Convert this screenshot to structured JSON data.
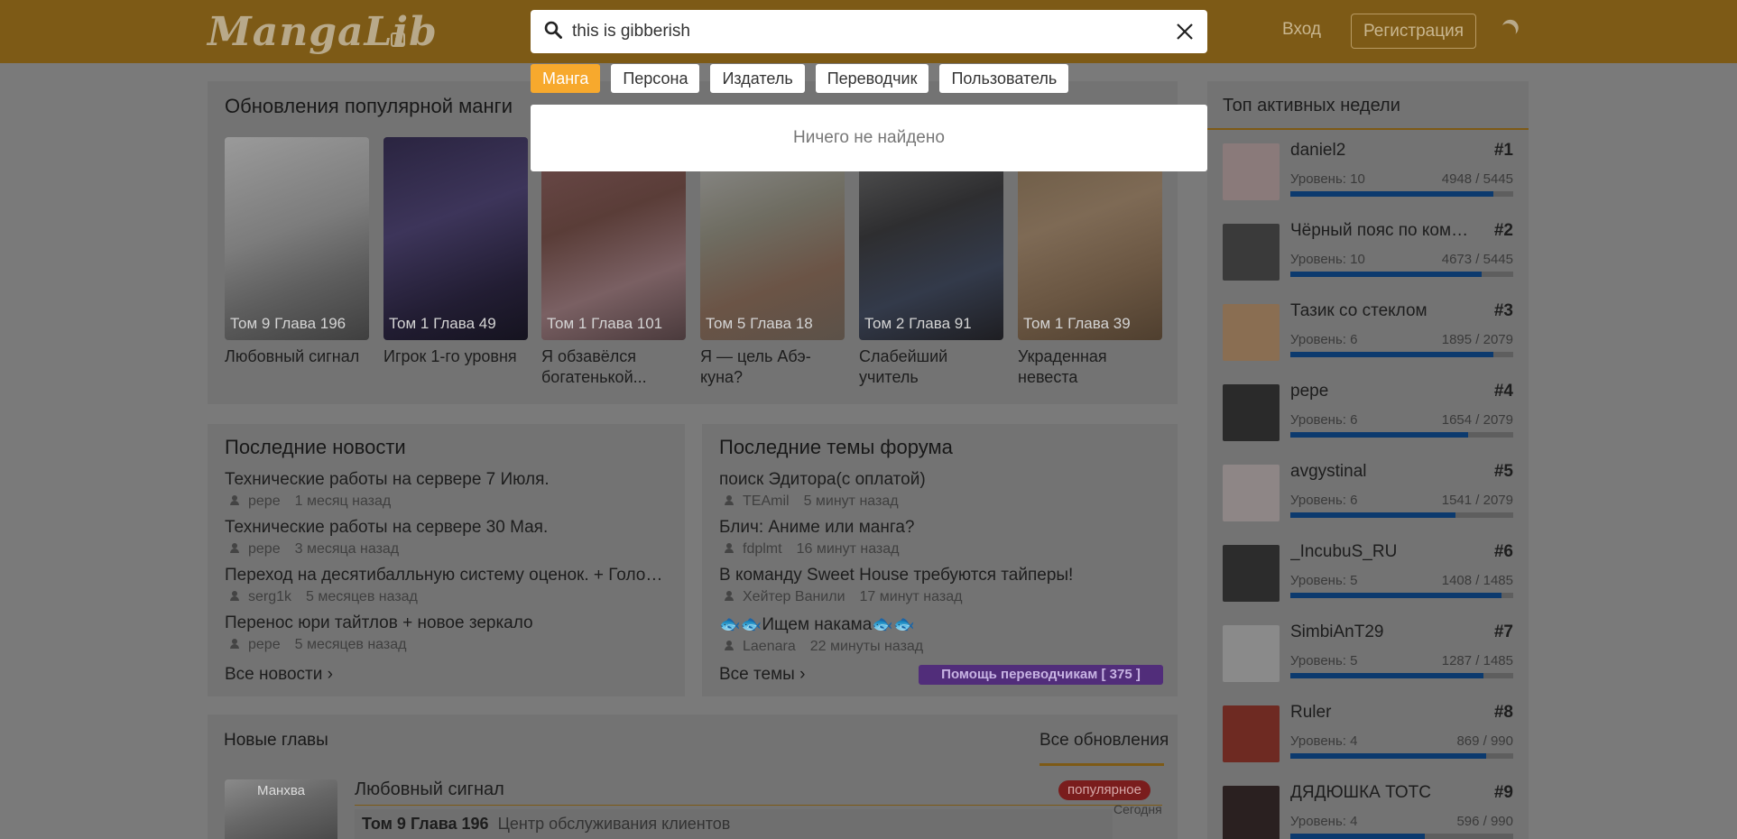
{
  "header": {
    "logo": "MangaLib",
    "login": "Вход",
    "register": "Регистрация"
  },
  "search": {
    "value": "this is gibberish",
    "filters": [
      "Манга",
      "Персона",
      "Издатель",
      "Переводчик",
      "Пользователь"
    ],
    "active_filter": "Манга",
    "no_results": "Ничего не найдено"
  },
  "updates": {
    "title": "Обновления популярной манги",
    "cards": [
      {
        "chapter": "Том 9 Глава 196",
        "name": "Любовный сигнал"
      },
      {
        "chapter": "Том 1 Глава 49",
        "name": "Игрок 1-го уровня"
      },
      {
        "chapter": "Том 1 Глава 101",
        "name": "Я обзавёлся богатенькой..."
      },
      {
        "chapter": "Том 5 Глава 18",
        "name": "Я — цель Абэ-куна?"
      },
      {
        "chapter": "Том 2 Глава 91",
        "name": "Слабейший учитель"
      },
      {
        "chapter": "Том 1 Глава 39",
        "name": "Украденная невеста"
      }
    ]
  },
  "news": {
    "title": "Последние новости",
    "items": [
      {
        "title": "Технические работы на сервере 7 Июля.",
        "author": "pepe",
        "time": "1 месяц назад"
      },
      {
        "title": "Технические работы на сервере 30 Мая.",
        "author": "pepe",
        "time": "3 месяца назад"
      },
      {
        "title": "Переход на десятибалльную систему оценок. + Голосование",
        "author": "serg1k",
        "time": "5 месяцев назад"
      },
      {
        "title": "Перенос юри тайтлов + новое зеркало",
        "author": "pepe",
        "time": "5 месяцев назад"
      }
    ],
    "all": "Все новости"
  },
  "forum": {
    "title": "Последние темы форума",
    "items": [
      {
        "title": "поиск Эдитора(с оплатой)",
        "author": "TEAmil",
        "time": "5 минут назад"
      },
      {
        "title": "Блич: Аниме или манга?",
        "author": "fdplmt",
        "time": "16 минут назад"
      },
      {
        "title": "В команду Sweet House требуются тайперы!",
        "author": "Хейтер Ванили",
        "time": "17 минут назад"
      },
      {
        "title": "🐟🐟Ищем накама🐟🐟",
        "author": "Laenara",
        "time": "22 минуты назад"
      }
    ],
    "all": "Все темы",
    "help": "Помощь переводчикам [ 375 ]"
  },
  "chapters": {
    "title": "Новые главы",
    "all": "Все обновления",
    "item": {
      "type": "Манхва",
      "name": "Любовный сигнал",
      "badge": "популярное",
      "volume": "Том 9 Глава 196",
      "subtitle": "Центр обслуживания клиентов",
      "time": "Сегодня"
    }
  },
  "top": {
    "title": "Топ активных недели",
    "users": [
      {
        "name": "daniel2",
        "rank": "#1",
        "level": "Уровень: 10",
        "xp": "4948 / 5445",
        "progress": 0.909
      },
      {
        "name": "Чёрный пояс по коммуникации",
        "rank": "#2",
        "level": "Уровень: 10",
        "xp": "4673 / 5445",
        "progress": 0.858
      },
      {
        "name": "Тазик со стеклом",
        "rank": "#3",
        "level": "Уровень: 6",
        "xp": "1895 / 2079",
        "progress": 0.912
      },
      {
        "name": "pepe",
        "rank": "#4",
        "level": "Уровень: 6",
        "xp": "1654 / 2079",
        "progress": 0.796
      },
      {
        "name": "avgystinal",
        "rank": "#5",
        "level": "Уровень: 6",
        "xp": "1541 / 2079",
        "progress": 0.741
      },
      {
        "name": "_IncubuS_RU",
        "rank": "#6",
        "level": "Уровень: 5",
        "xp": "1408 / 1485",
        "progress": 0.948
      },
      {
        "name": "SimbiAnT29",
        "rank": "#7",
        "level": "Уровень: 5",
        "xp": "1287 / 1485",
        "progress": 0.867
      },
      {
        "name": "Ruler",
        "rank": "#8",
        "level": "Уровень: 4",
        "xp": "869 / 990",
        "progress": 0.878
      },
      {
        "name": "ДЯДЮШКА ТОТС",
        "rank": "#9",
        "level": "Уровень: 4",
        "xp": "596 / 990",
        "progress": 0.602
      }
    ]
  },
  "colors": {
    "header": "#7d5a16",
    "accent": "#f7a92d",
    "progress": "#0c3a6e"
  }
}
